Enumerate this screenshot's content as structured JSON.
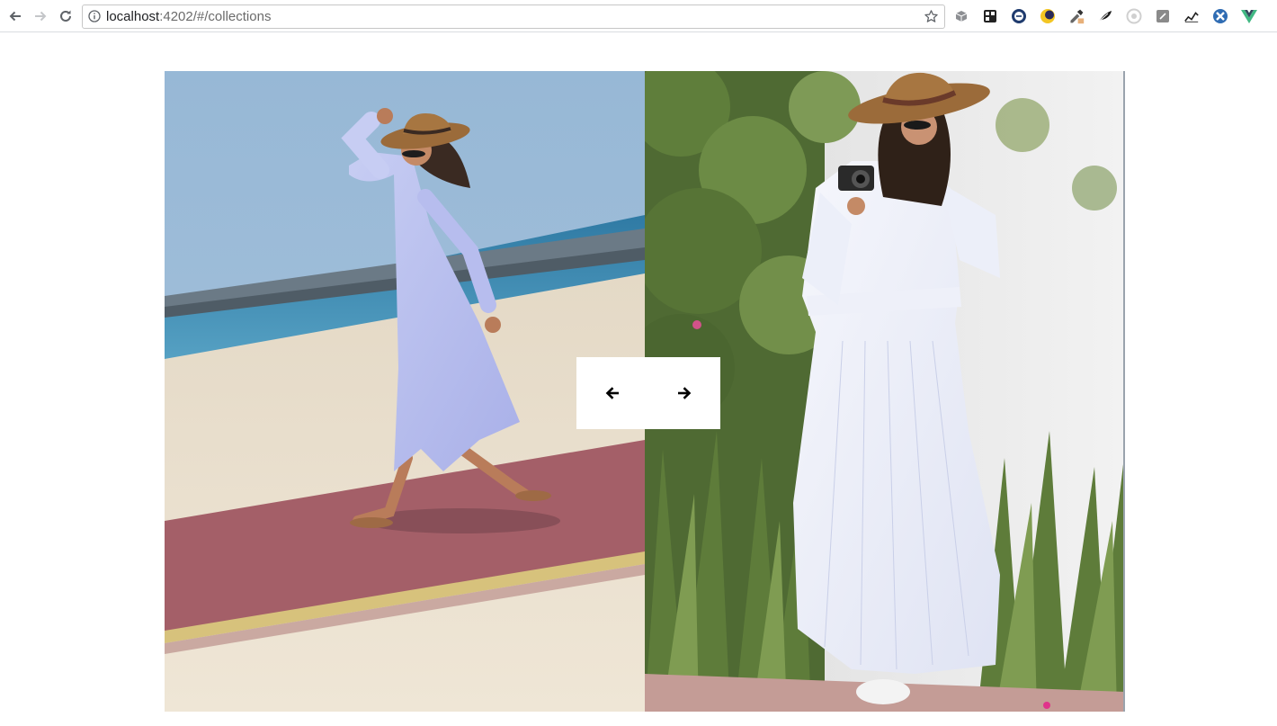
{
  "browser": {
    "url_host": "localhost",
    "url_rest": ":4202/#/collections",
    "nav_icons": [
      "back-icon",
      "forward-icon",
      "reload-icon"
    ],
    "extension_icons": [
      "cube-extension-icon",
      "grid-extension-icon",
      "e-circle-extension-icon",
      "moon-extension-icon",
      "eyedropper-extension-icon",
      "feather-extension-icon",
      "chrome-circle-extension-icon",
      "note-extension-icon",
      "graph-extension-icon",
      "cross-circle-extension-icon",
      "vue-extension-icon"
    ]
  },
  "carousel": {
    "slides": [
      {
        "subject": "woman in lavender shirt dress walking on beach promenade"
      },
      {
        "subject": "woman in striped white wrap dress holding camera by plants"
      }
    ],
    "controls": {
      "prev_icon": "arrow-left-icon",
      "next_icon": "arrow-right-icon"
    }
  }
}
